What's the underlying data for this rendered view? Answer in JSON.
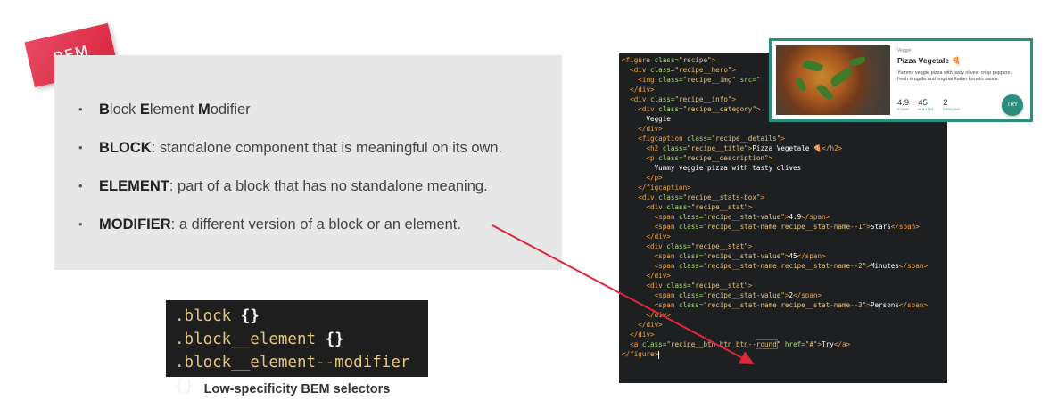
{
  "tag": "BEM",
  "bullets": [
    {
      "strong": "B",
      "rest1": "lock ",
      "strong2": "E",
      "rest2": "lement ",
      "strong3": "M",
      "rest3": "odifier"
    },
    {
      "strong": "BLOCK",
      "rest": ": standalone component that is meaningful on its own."
    },
    {
      "strong": "ELEMENT",
      "rest": ": part of a block that has no standalone meaning."
    },
    {
      "strong": "MODIFIER",
      "rest": ": a different version of a block or an element."
    }
  ],
  "selectors": [
    ".block",
    ".block__element",
    ".block__element--modifier"
  ],
  "selector_brace": "{}",
  "selectors_caption": "Low-specificity BEM selectors",
  "card": {
    "category": "Veggie",
    "title": "Pizza Vegetale 🍕",
    "description": "Yummy veggie pizza with tasty olives, crisp peppers, fresh arugula and original Italian tomato sauce.",
    "stats": [
      {
        "value": "4.9",
        "name": "STARS"
      },
      {
        "value": "45",
        "name": "MINUTES"
      },
      {
        "value": "2",
        "name": "PERSONS"
      }
    ],
    "button": "TRY"
  },
  "colors": {
    "accent": "#e0253f",
    "teal": "#2a8e7f",
    "code_bg": "#1d1f21"
  }
}
